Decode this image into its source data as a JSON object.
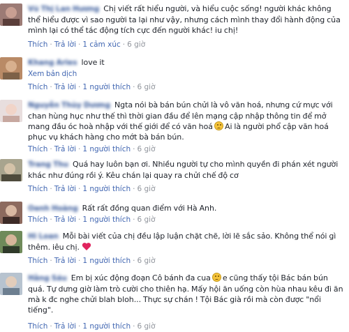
{
  "comments": [
    {
      "name": "Vũ Thị Lan Hương",
      "text": "Chị viết rất hiểu người, và hiểu cuộc sống! người khác không thể hiểu được vì sao người ta lại như vậy, nhưng cách mình thay đổi hành động của mình lại có thể tác động tích cực đến người khác! iu chị!",
      "like": "Thích",
      "reply": "Trả lời",
      "reactions": "1 cảm xúc",
      "time": "6 giờ"
    },
    {
      "name": "Khang Aries",
      "text": "love it",
      "see_translation": "Xem bản dịch",
      "like": "Thích",
      "reply": "Trả lời",
      "reactions": "1 người thích",
      "time": "6 giờ"
    },
    {
      "name": "Nguyễn Thùy Dương",
      "text_part1": "Ngta nói bà bán bún chửi là vô văn hoá, nhưng cứ mực với chan hùng hục như thế thì thời gian đầu để lên mạng cập nhập thông tin để mở mang đầu óc hoà nhập với thế giới để có văn hoá",
      "text_part2": "Ai là người phổ cập văn hoá phục vụ khách hàng cho mớt bà bán bún.",
      "emoji": "sad-face-icon",
      "like": "Thích",
      "reply": "Trả lời",
      "reactions": "1 người thích",
      "time": "6 giờ"
    },
    {
      "name": "Trang Thu",
      "text": "Quá hay luôn bạn ơi. Nhiều người tự cho mình quyền đi phán xét người khác như đúng rồi ý. Kêu chán lại quay ra chửi chế độ cơ",
      "like": "Thích",
      "reply": "Trả lời",
      "reactions": "1 người thích",
      "time": "6 giờ"
    },
    {
      "name": "Oanh Hoàng",
      "text": "Rất rất đồng quan điểm với Hà Anh.",
      "like": "Thích",
      "reply": "Trả lời",
      "reactions": "1 người thích",
      "time": "6 giờ"
    },
    {
      "name": "Hi Loan",
      "text": "Mỗi bài viết của chị đều lập luận chặt chẽ, lời lẽ sắc sảo. Không thể nói gì thêm. iêu chị.",
      "heart_icon": "heart-icon",
      "like": "Thích",
      "reply": "Trả lời",
      "reactions": "1 người thích",
      "time": "6 giờ"
    },
    {
      "name": "Hằng Sáu",
      "text_part1": "Em bị xúc động đoạn Cô bánh đa cua",
      "text_part2": "e cũng thấy tội Bác bán bún quá. Tự dưng giờ làm trò cười cho thiên hạ. Mấy hội ăn uống còn hùa nhau kêu đi ăn mà k đc nghe chửi blah bloh... Thực sự chán ! Tội Bác già rồi mà còn được \"nổi tiếng\".",
      "emoji": "sad-face-icon",
      "like": "Thích",
      "reply": "Trả lời",
      "reactions": "1 người thích",
      "time": "6 giờ"
    }
  ],
  "colors": {
    "link": "#4267b2",
    "name": "#365899",
    "meta": "#90949c",
    "text": "#1d2129",
    "heart": "#e0245e"
  }
}
